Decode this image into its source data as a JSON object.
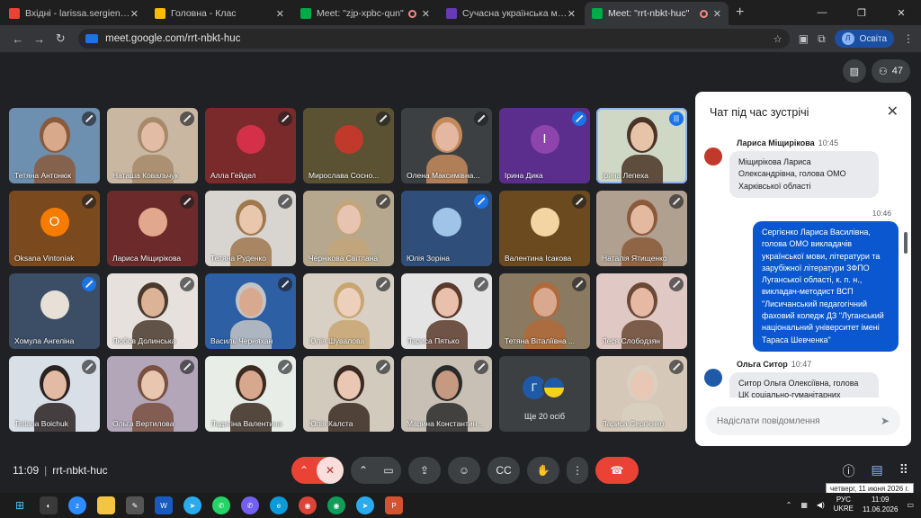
{
  "browser": {
    "tabs": [
      {
        "label": "Вхідні - larissa.sergienko@lispi",
        "color": "#ea4335"
      },
      {
        "label": "Головна - Клас",
        "color": "#fbbc04"
      },
      {
        "label": "Meet: \"zjp-xpbc-qun\"",
        "color": "#00ac47",
        "recording": true
      },
      {
        "label": "Сучасна українська мова з пр",
        "color": "#673ab7"
      },
      {
        "label": "Meet: \"rrt-nbkt-huc\"",
        "color": "#00ac47",
        "recording": true,
        "active": true
      }
    ],
    "new_tab": "+",
    "url": "meet.google.com/rrt-nbkt-huc",
    "profile_label": "Освіта",
    "profile_initial": "Л"
  },
  "meet": {
    "participant_count": "47",
    "participants": [
      {
        "name": "Тетяна Антонюк",
        "bg": "#6d8fb0",
        "skin": "#d9a98c",
        "hair": "#8a5a3c"
      },
      {
        "name": "Наташа Ковальчук",
        "bg": "#c9b7a2",
        "skin": "#e2bca4",
        "hair": "#a68a6a"
      },
      {
        "name": "Алла Гейдел",
        "bg": "#7a2a2a",
        "avatar_color": "#d4304a"
      },
      {
        "name": "Мирослава Сосно...",
        "bg": "#5a5232",
        "avatar_color": "#c0392b"
      },
      {
        "name": "Олена Максимівна...",
        "bg": "#3c4043",
        "skin": "#e3b7a0",
        "hair": "#c48a5a"
      },
      {
        "name": "Ірина Дика",
        "bg": "#5b2e8e",
        "letter": "І",
        "letter_bg": "#8e44ad"
      },
      {
        "name": "Ірина Лепеха",
        "bg": "#cfd8c4",
        "skin": "#e7c3a8",
        "hair": "#4a3426",
        "speaking": true
      },
      {
        "name": "Oksana Vintoniak",
        "bg": "#7a4a1e",
        "letter": "O",
        "letter_bg": "#f57c00"
      },
      {
        "name": "Лариса Міщирікова",
        "bg": "#6d2a2a",
        "avatar_color": "#e1a88e"
      },
      {
        "name": "Тетяна Руденко",
        "bg": "#d8d5d0",
        "skin": "#e9c7ad",
        "hair": "#a07850"
      },
      {
        "name": "Чернікова Світлана",
        "bg": "#b6a88e",
        "skin": "#e6c4b1",
        "hair": "#c2a57a"
      },
      {
        "name": "Юлія Зоріна",
        "bg": "#2f4f7a",
        "avatar_color": "#9fc4e8"
      },
      {
        "name": "Валентина Ісакова",
        "bg": "#6b4a1f",
        "avatar_color": "#f2d5a2"
      },
      {
        "name": "Наталія Ятищенко",
        "bg": "#b0a090",
        "skin": "#e3b9a0",
        "hair": "#8b5a3a"
      },
      {
        "name": "Хомула Ангеліна",
        "bg": "#3c4e66",
        "avatar_color": "#e8e0d6"
      },
      {
        "name": "Любов Долинська",
        "bg": "#e6e1dc",
        "skin": "#ddb398",
        "hair": "#4a3a2e"
      },
      {
        "name": "Василь Черняхан",
        "bg": "#2d5fa5",
        "skin": "#d8a98e",
        "hair": "#c4c4c4"
      },
      {
        "name": "Юлія Шувалова",
        "bg": "#d8d0c4",
        "skin": "#edd0bc",
        "hair": "#c8a672"
      },
      {
        "name": "Лариса Пятько",
        "bg": "#e4e4e4",
        "skin": "#e8c0ab",
        "hair": "#5a3a2a"
      },
      {
        "name": "Тетяна Віталіївна ...",
        "bg": "#8a7a62",
        "skin": "#d9a98f",
        "hair": "#b06a3a"
      },
      {
        "name": "Леся Слободзян",
        "bg": "#e0c8c4",
        "skin": "#e5b9a4",
        "hair": "#6a4a36"
      },
      {
        "name": "Tetiana Boichuk",
        "bg": "#d8dfe6",
        "skin": "#e3bba4",
        "hair": "#2a2222"
      },
      {
        "name": "Ольга Вертилова",
        "bg": "#b2a6b8",
        "skin": "#e8c6b0",
        "hair": "#7a5040"
      },
      {
        "name": "Ладягіна Валентина",
        "bg": "#e8ede8",
        "skin": "#d8a88e",
        "hair": "#3a2a20"
      },
      {
        "name": "Юлія Калста",
        "bg": "#d2cabd",
        "skin": "#eac7b2",
        "hair": "#3a2a22"
      },
      {
        "name": "Марина Константин...",
        "bg": "#c8c0b4",
        "skin": "#c69a80",
        "hair": "#2a2a2a"
      },
      {
        "name": "Лариса Сергієнко",
        "bg": "#d6c8b8",
        "skin": "#e8c8b4",
        "hair": "#d8d0c0"
      }
    ],
    "more": {
      "label": "Ще 20 осіб",
      "letter": "Г"
    },
    "meeting_code": "rrt-nbkt-huc",
    "time": "11:09"
  },
  "chat": {
    "title": "Чат під час зустрічі",
    "messages": [
      {
        "sender": "Лариса Міщирікова",
        "time": "10:45",
        "text": "Міщирікова Лариса Олександрівна, голова ОМО Харківської області",
        "avatar_color": "#c0392b"
      },
      {
        "time": "10:46",
        "text": "Сергієнко Лариса Василівна, голова ОМО викладачів української мови, літератури та зарубіжної літератури ЗФПО Луганської області, к. п. н., викладач-методист ВСП \"Лисичанський педагогічний фаховий коледж ДЗ \"Луганський національний університет імені Тараса Шевченка\"",
        "outgoing": true
      },
      {
        "sender": "Ольга Ситор",
        "time": "10:47",
        "text": "Ситор Ольга Олексіївна, голова ЦК соціально-гуманітарних",
        "avatar_color": "#1e5aa8"
      }
    ],
    "input_placeholder": "Надіслати повідомлення"
  },
  "taskbar": {
    "lang": "РУС",
    "lang2": "UKRE",
    "time": "11:09",
    "date": "11.06.2026",
    "tooltip": "четверг, 11 июня 2026 г."
  }
}
